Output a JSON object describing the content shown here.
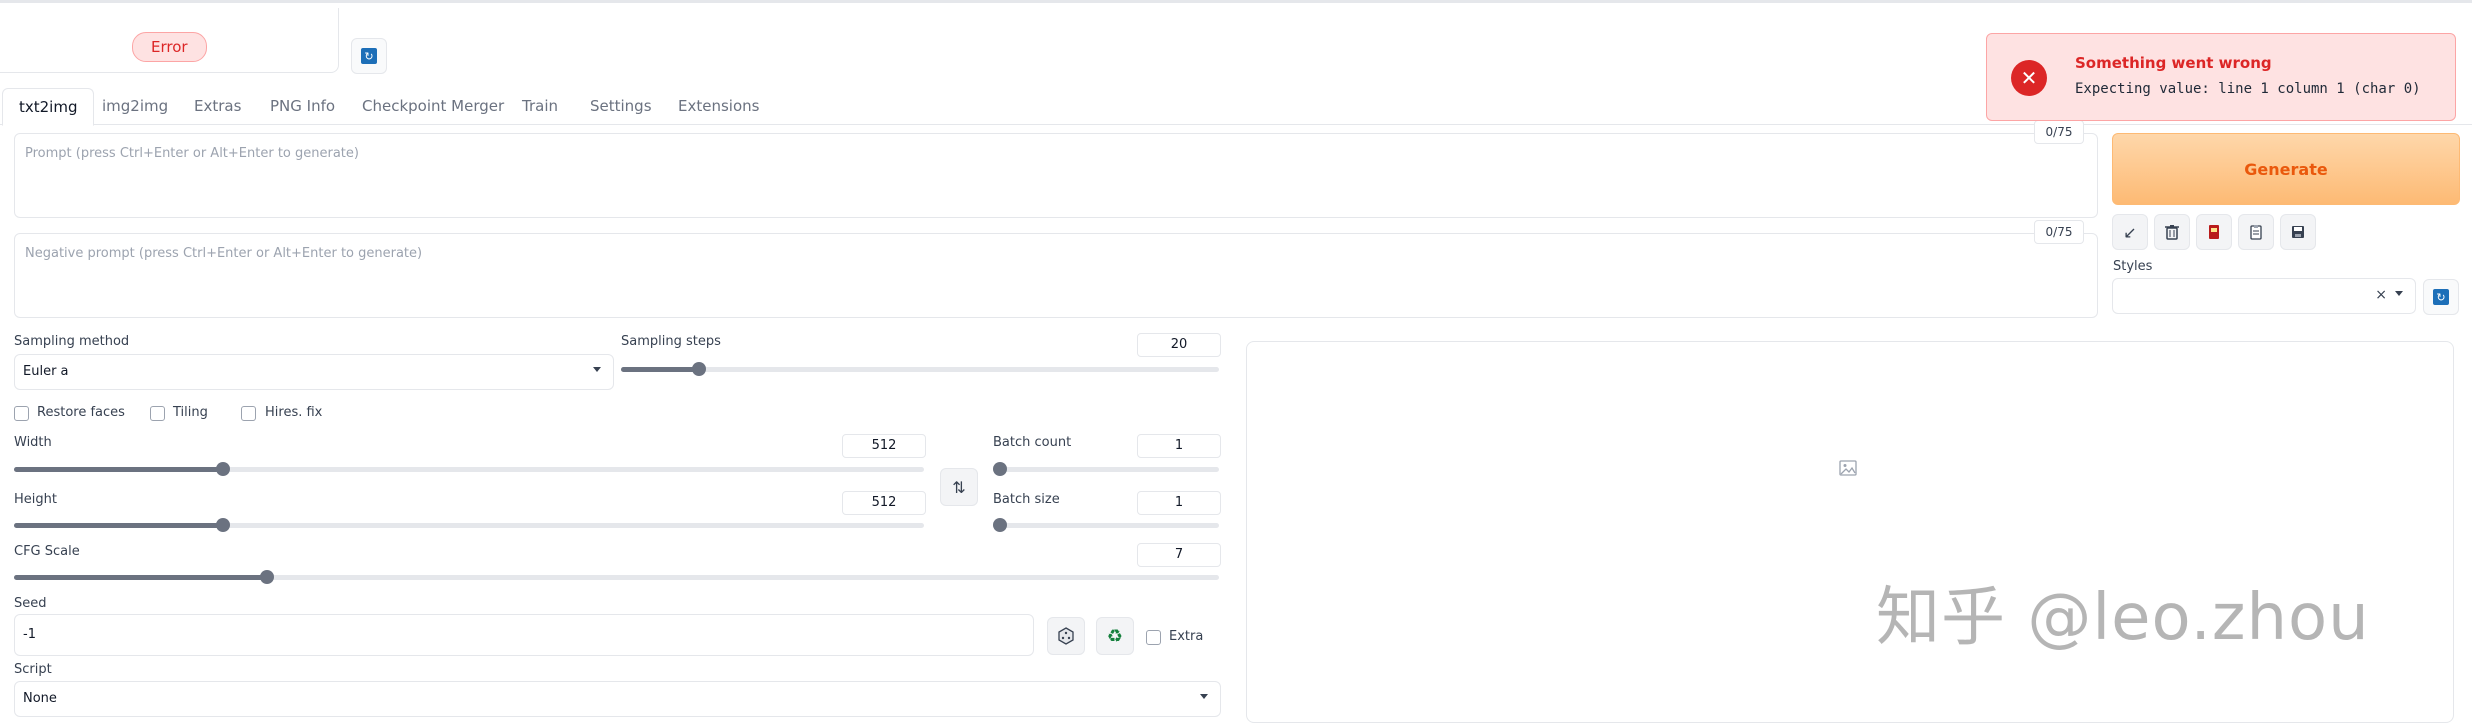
{
  "model": {
    "status": "Error"
  },
  "tabs": [
    "txt2img",
    "img2img",
    "Extras",
    "PNG Info",
    "Checkpoint Merger",
    "Train",
    "Settings",
    "Extensions"
  ],
  "prompt": {
    "placeholder": "Prompt (press Ctrl+Enter or Alt+Enter to generate)",
    "counter": "0/75"
  },
  "negative_prompt": {
    "placeholder": "Negative prompt (press Ctrl+Enter or Alt+Enter to generate)",
    "counter": "0/75"
  },
  "generate_label": "Generate",
  "tool_icons": [
    "arrow-diagonal-icon",
    "trash-icon",
    "red-book-icon",
    "clipboard-icon",
    "save-icon"
  ],
  "styles": {
    "label": "Styles",
    "clear": "×"
  },
  "sampling_method": {
    "label": "Sampling method",
    "value": "Euler a"
  },
  "sampling_steps": {
    "label": "Sampling steps",
    "value": "20",
    "fraction": 0.13
  },
  "checkboxes": [
    "Restore faces",
    "Tiling",
    "Hires. fix"
  ],
  "width": {
    "label": "Width",
    "value": "512",
    "fraction": 0.23
  },
  "height": {
    "label": "Height",
    "value": "512",
    "fraction": 0.23
  },
  "batch_count": {
    "label": "Batch count",
    "value": "1",
    "fraction": 0
  },
  "batch_size": {
    "label": "Batch size",
    "value": "1",
    "fraction": 0
  },
  "cfg_scale": {
    "label": "CFG Scale",
    "value": "7",
    "fraction": 0.21
  },
  "seed": {
    "label": "Seed",
    "value": "-1",
    "extra_label": "Extra"
  },
  "script": {
    "label": "Script",
    "value": "None"
  },
  "toast": {
    "title": "Something went wrong",
    "message": "Expecting value: line 1 column 1 (char 0)"
  },
  "watermark": "知乎 @leo.zhou",
  "colors": {
    "accent": "#ea580c",
    "error": "#dc2626",
    "refresh": "#1d6fb8"
  }
}
